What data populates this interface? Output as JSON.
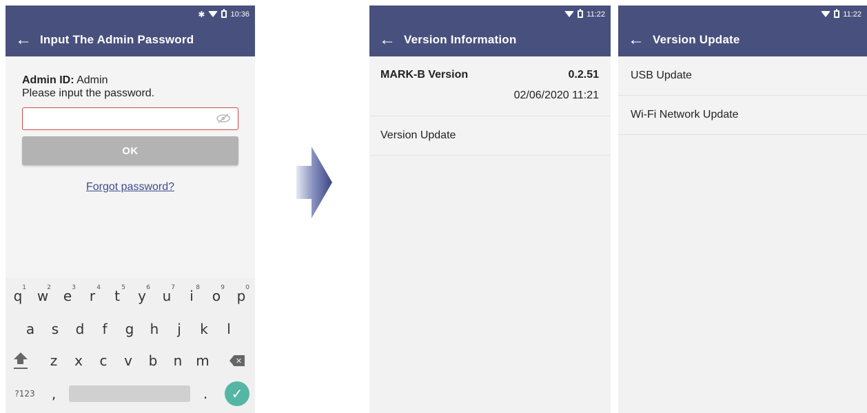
{
  "screen1": {
    "status": {
      "time": "10:36",
      "icons": [
        "bluetooth-icon",
        "wifi-icon",
        "battery-icon"
      ]
    },
    "appbar": {
      "back_icon": "arrow-left-icon",
      "title": "Input The Admin Password"
    },
    "admin_id_label": "Admin ID:",
    "admin_id_value": "Admin",
    "prompt": "Please input the password.",
    "password_field": {
      "value": "",
      "icon": "eye-off-icon"
    },
    "ok_label": "OK",
    "forgot_label": "Forgot password?",
    "keyboard": {
      "row1": [
        "q",
        "w",
        "e",
        "r",
        "t",
        "y",
        "u",
        "i",
        "o",
        "p"
      ],
      "row1_hints": [
        "1",
        "2",
        "3",
        "4",
        "5",
        "6",
        "7",
        "8",
        "9",
        "0"
      ],
      "row2": [
        "a",
        "s",
        "d",
        "f",
        "g",
        "h",
        "j",
        "k",
        "l"
      ],
      "row3": [
        "z",
        "x",
        "c",
        "v",
        "b",
        "n",
        "m"
      ],
      "symbols_label": "?123",
      "comma": ",",
      "period": "."
    }
  },
  "screen2": {
    "status": {
      "time": "11:22"
    },
    "appbar": {
      "title": "Version Information"
    },
    "version_label": "MARK-B Version",
    "version_value": "0.2.51",
    "version_date": "02/06/2020 11:21",
    "update_label": "Version Update"
  },
  "screen3": {
    "status": {
      "time": "11:22"
    },
    "appbar": {
      "title": "Version Update"
    },
    "items": [
      "USB Update",
      "Wi-Fi Network Update"
    ]
  },
  "colors": {
    "appbar": "#48507e",
    "field_border": "#d24a4a",
    "link": "#3d4b8d",
    "ok_button": "#b3b3b3",
    "enter_key": "#55b6a4"
  }
}
